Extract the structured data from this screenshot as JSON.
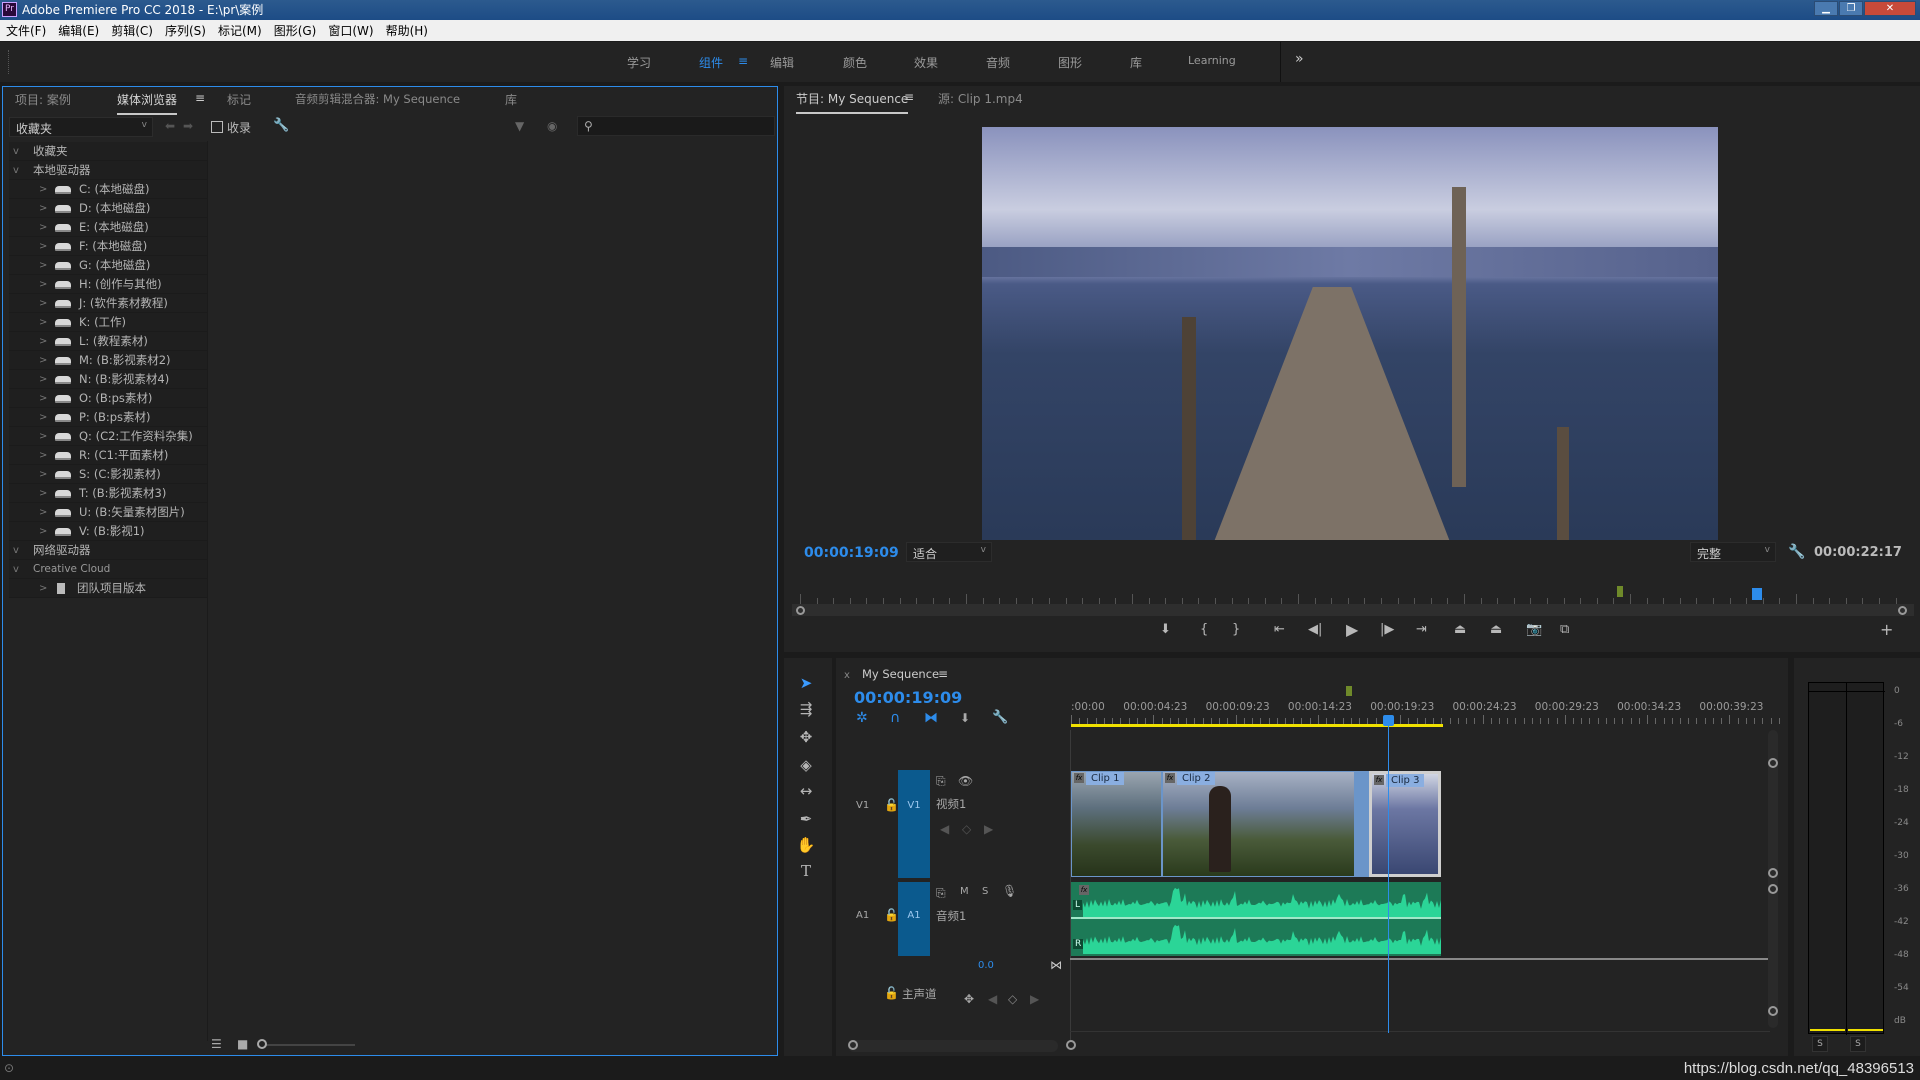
{
  "window": {
    "title": "Adobe Premiere Pro CC 2018 - E:\\pr\\案例",
    "logo": "Pr"
  },
  "menu": [
    "文件(F)",
    "编辑(E)",
    "剪辑(C)",
    "序列(S)",
    "标记(M)",
    "图形(G)",
    "窗口(W)",
    "帮助(H)"
  ],
  "workspaces": {
    "items": [
      "学习",
      "组件",
      "编辑",
      "颜色",
      "效果",
      "音频",
      "图形",
      "库",
      "Learning"
    ],
    "active": "组件",
    "more": "»"
  },
  "left_panel": {
    "tabs": [
      "项目: 案例",
      "媒体浏览器",
      "标记",
      "音频剪辑混合器: My Sequence",
      "库"
    ],
    "active_tab": "媒体浏览器",
    "location_select": "收藏夹",
    "ingest_label": "收录",
    "search_placeholder": "",
    "tree": {
      "favorites": "收藏夹",
      "local_drives": "本地驱动器",
      "drives": [
        "C: (本地磁盘)",
        "D: (本地磁盘)",
        "E: (本地磁盘)",
        "F: (本地磁盘)",
        "G: (本地磁盘)",
        "H: (创作与其他)",
        "J: (软件素材教程)",
        "K: (工作)",
        "L: (教程素材)",
        "M: (B:影视素材2)",
        "N: (B:影视素材4)",
        "O: (B:ps素材)",
        "P: (B:ps素材)",
        "Q: (C2:工作资料杂集)",
        "R: (C1:平面素材)",
        "S: (C:影视素材)",
        "T: (B:影视素材3)",
        "U: (B:矢量素材图片)",
        "V: (B:影视1)"
      ],
      "network_drives": "网络驱动器",
      "creative_cloud": "Creative Cloud",
      "team_projects": "团队项目版本"
    }
  },
  "program_monitor": {
    "tabs": [
      "节目: My Sequence",
      "源: Clip 1.mp4"
    ],
    "current_timecode": "00:00:19:09",
    "zoom_select": "适合",
    "quality_select": "完整",
    "duration": "00:00:22:17",
    "playhead_fraction": 0.856
  },
  "timeline": {
    "sequence_name": "My Sequence",
    "timecode": "00:00:19:09",
    "ruler": [
      ":00:00",
      "00:00:04:23",
      "00:00:09:23",
      "00:00:14:23",
      "00:00:19:23",
      "00:00:24:23",
      "00:00:29:23",
      "00:00:34:23",
      "00:00:39:23"
    ],
    "tracks": {
      "video": {
        "id": "V1",
        "target": "V1",
        "name": "视频1"
      },
      "audio": {
        "id": "A1",
        "target": "A1",
        "name": "音频1",
        "mute": "M",
        "solo": "S"
      },
      "master": {
        "name": "主声道",
        "level": "0.0"
      }
    },
    "clips": [
      "Clip 1",
      "Clip 2",
      "Clip 3"
    ],
    "channels": [
      "L",
      "R"
    ]
  },
  "audio_meter": {
    "scale": [
      "0",
      "-6",
      "-12",
      "-18",
      "-24",
      "-30",
      "-36",
      "-42",
      "-48",
      "-54",
      "dB"
    ],
    "solo": [
      "S",
      "S"
    ]
  },
  "watermark": "https://blog.csdn.net/qq_48396513",
  "colors": {
    "accent": "#2d8ceb",
    "timecode": "#2d8ceb",
    "audio_wave": "#2bd597",
    "track_target": "#0b5a8e",
    "work_area": "#f0e000"
  }
}
